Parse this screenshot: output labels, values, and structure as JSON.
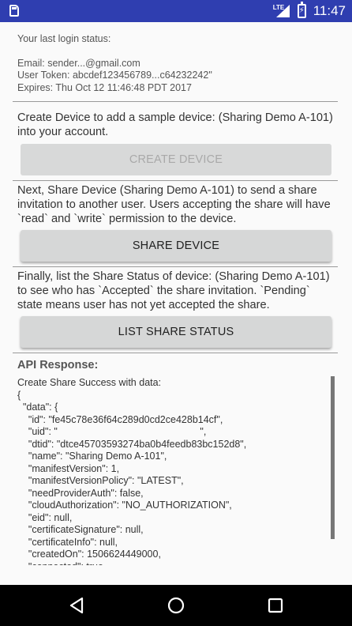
{
  "status_bar": {
    "network": "LTE",
    "time": "11:47"
  },
  "login_status": {
    "heading": "Your last login status:",
    "email": "Email:  sender...@gmail.com",
    "user_token": "User Token: abcdef123456789...c64232242\"",
    "expires": "Expires: Thu Oct 12 11:46:48 PDT 2017"
  },
  "create_section": {
    "description": "Create Device to add a sample device: (Sharing Demo A-101) into your account.",
    "button_label": "CREATE DEVICE",
    "button_enabled": false
  },
  "share_section": {
    "description": "Next, Share Device (Sharing Demo A-101) to send a share invitation to another user.  Users accepting the share will have `read` and `write` permission to the device.",
    "button_label": "SHARE DEVICE"
  },
  "status_section": {
    "description": "Finally, list the Share Status of device: (Sharing Demo A-101) to see who has `Accepted` the share invitation. `Pending` state means user has not yet accepted the share.",
    "button_label": "LIST SHARE STATUS"
  },
  "api_response": {
    "title": "API Response:",
    "lines": [
      "Create Share Success with data:",
      "{",
      "  \"data\": {",
      "    \"id\": \"fe45c78e36f64c289d0cd2ce428b14cf\",",
      "    \"uid\": \"                                                    \",",
      "    \"dtid\": \"dtce45703593274ba0b4feedb83bc152d8\",",
      "    \"name\": \"Sharing Demo A-101\",",
      "    \"manifestVersion\": 1,",
      "    \"manifestVersionPolicy\": \"LATEST\",",
      "    \"needProviderAuth\": false,",
      "    \"cloudAuthorization\": \"NO_AUTHORIZATION\",",
      "    \"eid\": null,",
      "    \"certificateSignature\": null,",
      "    \"certificateInfo\": null,",
      "    \"createdOn\": 1506624449000,",
      "    \"connected\": true,"
    ]
  },
  "navigation": {
    "back_icon": "triangle-back-icon",
    "home_icon": "circle-home-icon",
    "recents_icon": "square-recents-icon"
  },
  "colors": {
    "status_bar": "#2f3eb0",
    "background": "#fafafa",
    "button": "#d6d7d7",
    "nav_bar": "#000000"
  }
}
